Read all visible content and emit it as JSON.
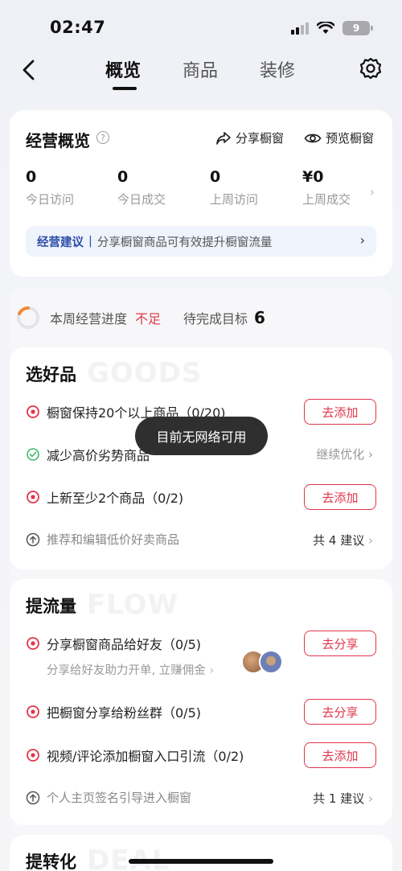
{
  "status_bar": {
    "time": "02:47",
    "battery": "9"
  },
  "nav": {
    "tabs": [
      "概览",
      "商品",
      "装修"
    ],
    "active_tab": 0
  },
  "overview": {
    "title": "经营概览",
    "help_icon": "?",
    "share_label": "分享橱窗",
    "preview_label": "预览橱窗",
    "stats": [
      {
        "value": "0",
        "label": "今日访问"
      },
      {
        "value": "0",
        "label": "今日成交"
      },
      {
        "value": "0",
        "label": "上周访问"
      },
      {
        "value": "¥0",
        "label": "上周成交"
      }
    ],
    "advice_label": "经营建议",
    "advice_sep": "|",
    "advice_text": "分享橱窗商品可有效提升橱窗流量"
  },
  "progress": {
    "label": "本周经营进度",
    "status": "不足",
    "goal_label": "待完成目标",
    "goal_count": "6"
  },
  "sections": {
    "goods": {
      "title": "选好品",
      "watermark": "GOODS",
      "tasks": [
        {
          "text": "橱窗保持20个以上商品（0/20)",
          "action": "去添加"
        },
        {
          "text": "减少高价劣势商品",
          "action": "继续优化"
        },
        {
          "text": "上新至少2个商品（0/2)",
          "action": "去添加"
        }
      ],
      "footer_text": "推荐和编辑低价好卖商品",
      "footer_count": "共 4 建议"
    },
    "flow": {
      "title": "提流量",
      "watermark": "FLOW",
      "tasks": [
        {
          "text": "分享橱窗商品给好友（0/5)",
          "action": "去分享",
          "sub": "分享给好友助力开单, 立赚佣金"
        },
        {
          "text": "把橱窗分享给粉丝群（0/5)",
          "action": "去分享"
        },
        {
          "text": "视频/评论添加橱窗入口引流（0/2)",
          "action": "去添加"
        }
      ],
      "footer_text": "个人主页签名引导进入橱窗",
      "footer_count": "共 1 建议"
    },
    "deal": {
      "title": "提转化",
      "watermark": "DEAL"
    }
  },
  "toast": "目前无网络可用",
  "colors": {
    "accent": "#e0364a",
    "advice_blue": "#2b4ea8",
    "success": "#3dbb6b"
  }
}
